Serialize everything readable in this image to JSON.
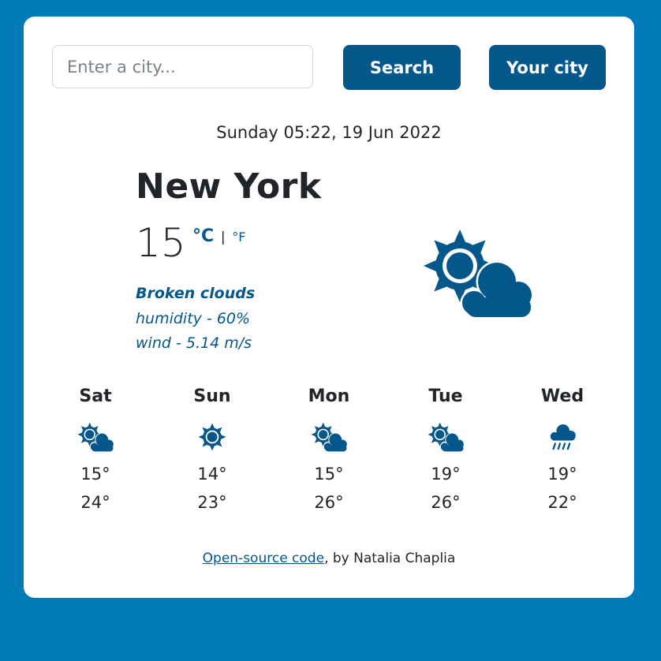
{
  "search": {
    "placeholder": "Enter a city...",
    "value": "",
    "search_label": "Search",
    "your_city_label": "Your city"
  },
  "current": {
    "date": "Sunday 05:22, 19 Jun 2022",
    "city": "New York",
    "temperature": "15",
    "unit_celsius": "°C",
    "unit_separator": "|",
    "unit_fahrenheit": "°F",
    "description": "Broken clouds",
    "humidity": "humidity - 60%",
    "wind": "wind - 5.14 m/s",
    "icon": "sun-behind-cloud-icon"
  },
  "forecast": [
    {
      "day": "Sat",
      "min": "15°",
      "max": "24°",
      "icon": "sun-behind-cloud-icon"
    },
    {
      "day": "Sun",
      "min": "14°",
      "max": "23°",
      "icon": "sun-icon"
    },
    {
      "day": "Mon",
      "min": "15°",
      "max": "26°",
      "icon": "sun-behind-cloud-icon"
    },
    {
      "day": "Tue",
      "min": "19°",
      "max": "26°",
      "icon": "sun-behind-cloud-icon"
    },
    {
      "day": "Wed",
      "min": "19°",
      "max": "22°",
      "icon": "rain-cloud-icon"
    }
  ],
  "footer": {
    "link_text": "Open-source code",
    "rest_text": ", by Natalia Chaplia"
  },
  "colors": {
    "background": "#007bb8",
    "accent": "#04578a",
    "card": "#ffffff"
  }
}
